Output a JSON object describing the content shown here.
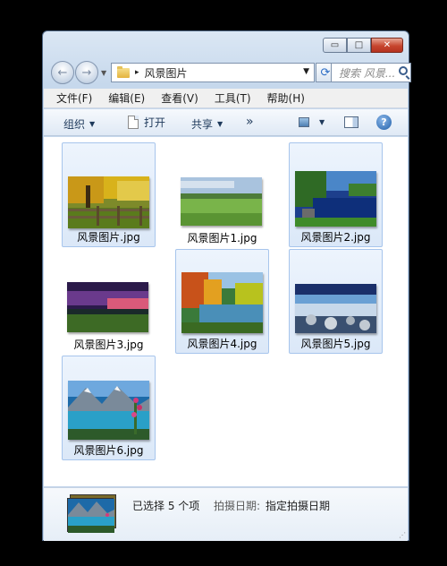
{
  "window": {
    "caption_buttons": {
      "minimize": "▭",
      "maximize": "□",
      "close": "✕"
    }
  },
  "navigation": {
    "back_glyph": "←",
    "forward_glyph": "→",
    "path_separator": "▸",
    "folder_name": "风景图片",
    "search_placeholder": "搜索 风景...",
    "refresh_glyph": "⟳"
  },
  "menu": [
    "文件(F)",
    "编辑(E)",
    "查看(V)",
    "工具(T)",
    "帮助(H)"
  ],
  "toolbar": {
    "organize": "组织",
    "open": "打开",
    "share": "共享",
    "more": "»",
    "help": "?"
  },
  "files": [
    {
      "name": "风景图片.jpg",
      "selected": true
    },
    {
      "name": "风景图片1.jpg",
      "selected": false
    },
    {
      "name": "风景图片2.jpg",
      "selected": true
    },
    {
      "name": "风景图片3.jpg",
      "selected": false
    },
    {
      "name": "风景图片4.jpg",
      "selected": true
    },
    {
      "name": "风景图片5.jpg",
      "selected": true
    },
    {
      "name": "风景图片6.jpg",
      "selected": true
    }
  ],
  "details": {
    "selection_count": "已选择 5 个项",
    "date_label": "拍摄日期:",
    "date_value": "指定拍摄日期"
  },
  "icons": {
    "search": "search-icon",
    "folder": "folder-icon",
    "help": "help-icon"
  }
}
